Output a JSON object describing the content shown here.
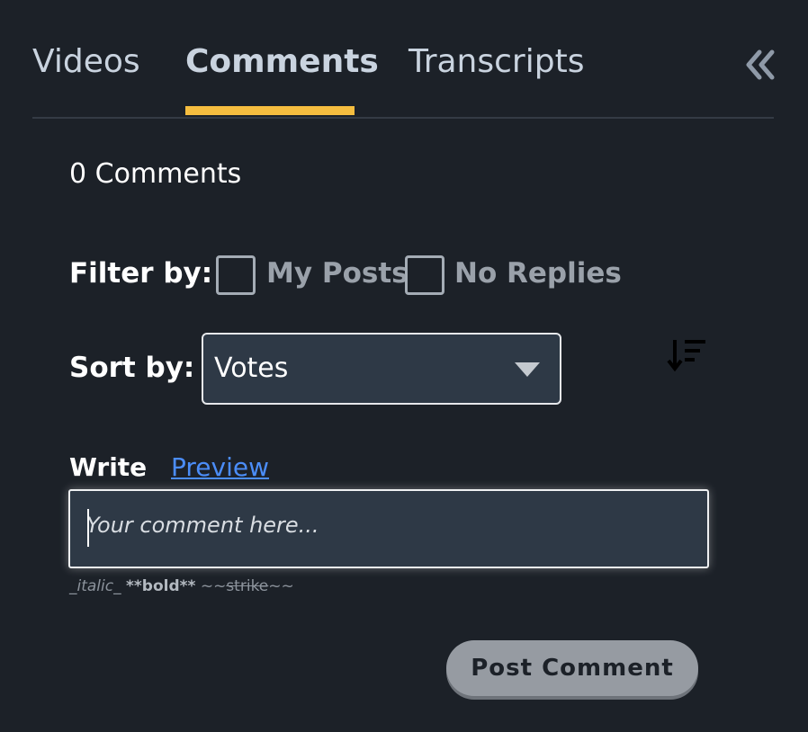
{
  "tabs": [
    {
      "label": "Videos",
      "active": false
    },
    {
      "label": "Comments",
      "active": true
    },
    {
      "label": "Transcripts",
      "active": false
    }
  ],
  "accent_color": "#f5bd3f",
  "link_color": "#4b8df8",
  "collapse_icon": "double-chevron-left-icon",
  "comments": {
    "count_label": "0 Comments"
  },
  "filter": {
    "label": "Filter by:",
    "options": [
      {
        "label": "My Posts",
        "checked": false
      },
      {
        "label": "No Replies",
        "checked": false
      }
    ]
  },
  "sort": {
    "label": "Sort by:",
    "selected": "Votes",
    "direction_icon": "sort-descending-icon"
  },
  "editor": {
    "write_tab": "Write",
    "preview_tab": "Preview",
    "placeholder": "Your comment here...",
    "hint_italic": "_italic_",
    "hint_bold": "**bold**",
    "hint_strike_open": "~~",
    "hint_strike_word": "strike",
    "hint_strike_close": "~~"
  },
  "post_button": "Post Comment"
}
